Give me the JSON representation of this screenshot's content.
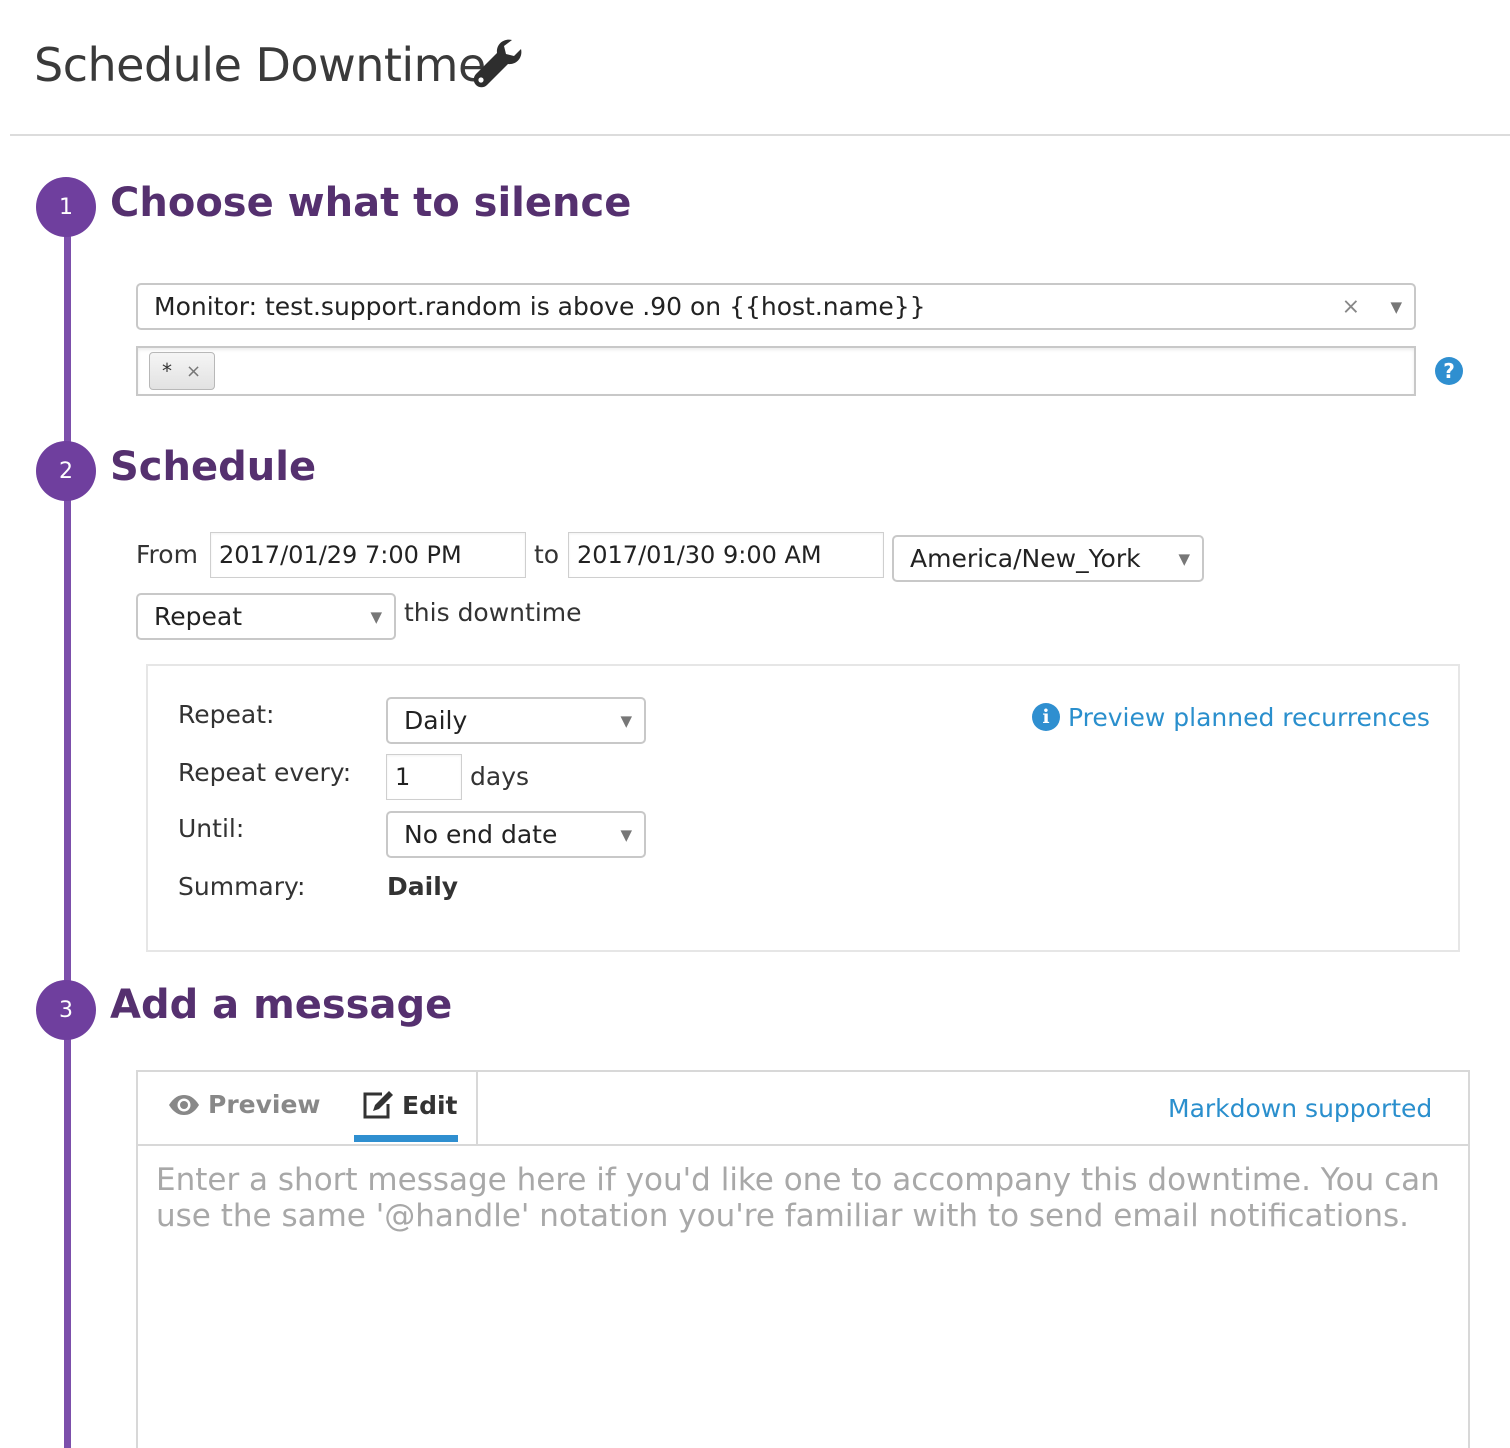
{
  "header": {
    "title": "Schedule Downtime",
    "icon": "wrench-icon"
  },
  "steps": [
    {
      "number": "1",
      "title": "Choose what to silence"
    },
    {
      "number": "2",
      "title": "Schedule"
    },
    {
      "number": "3",
      "title": "Add a message"
    }
  ],
  "silence": {
    "monitor_value": "Monitor: test.support.random is above .90 on {{host.name}}",
    "clear_symbol": "×",
    "scope_tags": [
      {
        "label": "*",
        "remove": "×"
      }
    ],
    "help_symbol": "?"
  },
  "schedule": {
    "from_label": "From",
    "from_value": "2017/01/29 7:00 PM",
    "to_label": "to",
    "to_value": "2017/01/30 9:00 AM",
    "timezone": "America/New_York",
    "mode": "Repeat",
    "mode_suffix": "this downtime",
    "repeat": {
      "repeat_label": "Repeat:",
      "repeat_value": "Daily",
      "every_label": "Repeat every:",
      "every_value": "1",
      "every_unit": "days",
      "until_label": "Until:",
      "until_value": "No end date",
      "summary_label": "Summary:",
      "summary_value": "Daily",
      "preview_link": "Preview planned recurrences",
      "info_symbol": "i"
    }
  },
  "message": {
    "tab_preview": "Preview",
    "tab_edit": "Edit",
    "active_tab": "Edit",
    "markdown_link": "Markdown supported",
    "placeholder": "Enter a short message here if you'd like one to accompany this downtime. You can use the same '@handle' notation you're familiar with to send email notifications."
  },
  "colors": {
    "accent_purple": "#6f3f9e",
    "heading_purple": "#55306f",
    "link_blue": "#2a8fcd"
  }
}
